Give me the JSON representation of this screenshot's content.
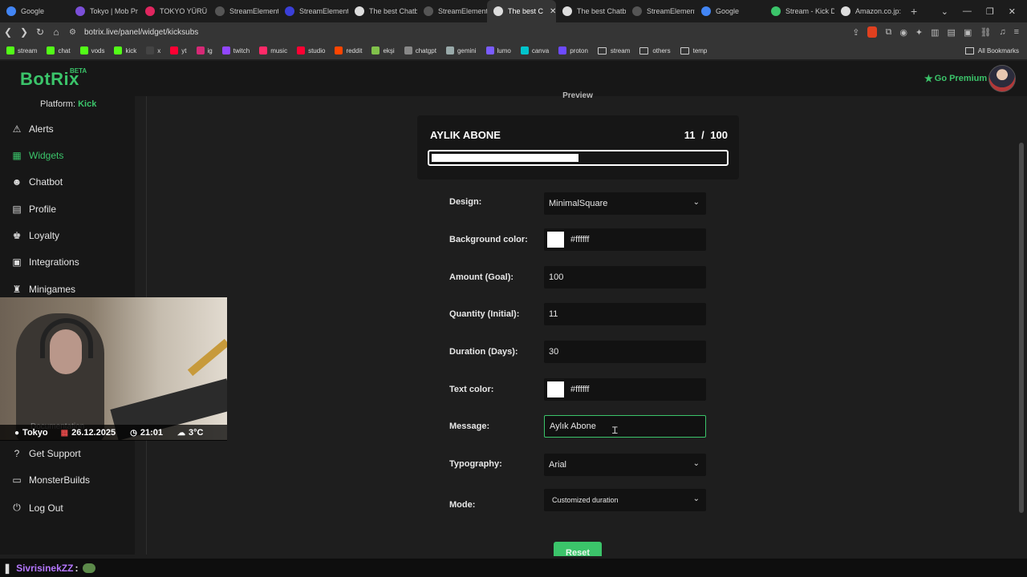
{
  "browser": {
    "tabs": [
      {
        "title": "Google",
        "color": "#4285f4",
        "width": 86
      },
      {
        "title": "Tokyo | Mob Pr",
        "color": "#7b4fd8",
        "width": 87
      },
      {
        "title": "TOKYO YÜRÜ",
        "color": "#e0265f",
        "width": 87
      },
      {
        "title": "StreamElement",
        "color": "#555",
        "width": 87
      },
      {
        "title": "StreamElement",
        "color": "#3a3fd8",
        "width": 87
      },
      {
        "title": "The best Chatb",
        "color": "#ddd",
        "width": 86
      },
      {
        "title": "StreamElement",
        "color": "#555",
        "width": 87
      },
      {
        "title": "The best C",
        "color": "#ddd",
        "width": 86,
        "active": true,
        "close": "✕"
      },
      {
        "title": "The best Chatb",
        "color": "#ddd",
        "width": 87
      },
      {
        "title": "StreamElement",
        "color": "#555",
        "width": 86
      },
      {
        "title": "Google",
        "color": "#4285f4",
        "width": 87
      },
      {
        "title": "Stream - Kick D",
        "color": "#3bc46a",
        "width": 87
      },
      {
        "title": "Amazon.co.jp:",
        "color": "#ddd",
        "width": 87
      }
    ],
    "new_tab": "+",
    "window_controls": [
      "⌄",
      "—",
      "❐",
      "✕"
    ],
    "url": "botrix.live/panel/widget/kicksubs",
    "bookmarks": [
      {
        "label": "stream",
        "color": "#53fc18"
      },
      {
        "label": "chat",
        "color": "#53fc18"
      },
      {
        "label": "vods",
        "color": "#53fc18"
      },
      {
        "label": "kick",
        "color": "#53fc18"
      },
      {
        "label": "x",
        "color": "#444"
      },
      {
        "label": "yt",
        "color": "#ff0033"
      },
      {
        "label": "ig",
        "color": "#d62976"
      },
      {
        "label": "twitch",
        "color": "#9146ff"
      },
      {
        "label": "music",
        "color": "#ff2a68"
      },
      {
        "label": "studio",
        "color": "#ff0033"
      },
      {
        "label": "reddit",
        "color": "#ff4500"
      },
      {
        "label": "ekşi",
        "color": "#81c14b"
      },
      {
        "label": "chatgpt",
        "color": "#888"
      },
      {
        "label": "gemini",
        "color": "#9aa"
      },
      {
        "label": "lumo",
        "color": "#7a5cff"
      },
      {
        "label": "canva",
        "color": "#00c4cc"
      },
      {
        "label": "proton",
        "color": "#6d4aff"
      },
      {
        "label": "stream",
        "folder": true
      },
      {
        "label": "others",
        "folder": true
      },
      {
        "label": "temp",
        "folder": true
      }
    ],
    "all_bookmarks": "All Bookmarks"
  },
  "header": {
    "logo": "BotRix",
    "beta": "BETA",
    "premium": "Go Premium"
  },
  "sidebar": {
    "platform_label": "Platform: ",
    "platform_value": "Kick",
    "items": [
      {
        "label": "Alerts",
        "icon": "⚠"
      },
      {
        "label": "Widgets",
        "icon": "▦",
        "active": true
      },
      {
        "label": "Chatbot",
        "icon": "☻"
      },
      {
        "label": "Profile",
        "icon": "▤"
      },
      {
        "label": "Loyalty",
        "icon": "♚"
      },
      {
        "label": "Integrations",
        "icon": "▣"
      },
      {
        "label": "Minigames",
        "icon": "♜"
      }
    ],
    "bottom_items": [
      {
        "label": "Get Support",
        "icon": "?"
      },
      {
        "label": "MonsterBuilds",
        "icon": "▭"
      },
      {
        "label": "Log Out",
        "icon": "⏻"
      }
    ],
    "ghost_text": "Documentation"
  },
  "overlay": {
    "city": "Tokyo",
    "date": "26.12.2025",
    "time": "21:01",
    "temp": "3°C"
  },
  "preview": {
    "label": "Preview",
    "title": "AYLIK ABONE",
    "current": "11",
    "goal": "/ 100",
    "progress": 0.5
  },
  "form": {
    "design_label": "Design:",
    "design_value": "MinimalSquare",
    "bg_label": "Background color:",
    "bg_value": "#ffffff",
    "amount_label": "Amount (Goal):",
    "amount_value": "100",
    "quantity_label": "Quantity (Initial):",
    "quantity_value": "11",
    "duration_label": "Duration (Days):",
    "duration_value": "30",
    "textcolor_label": "Text color:",
    "textcolor_value": "#ffffff",
    "message_label": "Message:",
    "message_value": "Aylık Abone",
    "typography_label": "Typography:",
    "typography_value": "Arial",
    "mode_label": "Mode:",
    "mode_value": "Customized duration",
    "reset": "Reset"
  },
  "chat": {
    "user": "SivrisinekZZ",
    "colon": ":"
  },
  "colors": {
    "accent": "#3bc46a",
    "swatch": "#ffffff"
  }
}
